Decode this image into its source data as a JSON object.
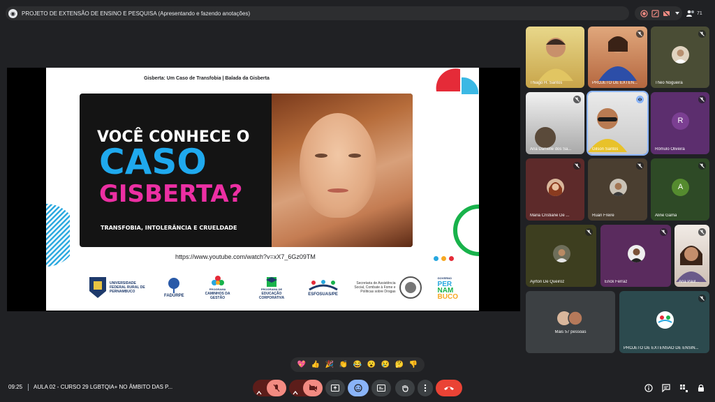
{
  "meeting": {
    "presentation_title": "PROJETO DE EXTENSÃO DE ENSINO E PESQUISA (Apresentando e fazendo anotações)",
    "participant_count": "71",
    "time": "09:25",
    "name": "AULA 02 - CURSO 29 LGBTQIA+ NO ÂMBITO DAS P..."
  },
  "slide": {
    "title": "Gisberta: Um Caso de Transfobia | Balada da Gisberta",
    "line1": "VOCÊ CONHECE O",
    "line2": "CASO",
    "line3": "GISBERTA?",
    "subtitle": "TRANSFOBIA, INTOLERÂNCIA E CRUELDADE",
    "url": "https://www.youtube.com/watch?v=xX7_6Gz09TM",
    "logos": {
      "ufrpe": "UNIVERSIDADE FEDERAL RURAL DE PERNAMBUCO",
      "fadurpe": "FADURPE",
      "caminhos_top": "PROGRAMA",
      "caminhos": "CAMINHOS DA GESTÃO",
      "educacao_top": "PROGRAMA DE",
      "educacao": "EDUCAÇÃO CORPORATIVA",
      "esfosuas": "ESFOSUAS/PE",
      "secretaria": "Secretaria de Assistência Social, Combate à Fome e Políticas sobre Drogas",
      "governo_top": "GOVERNO",
      "governo_1": "PER",
      "governo_2": "NAM",
      "governo_3": "BUCO"
    }
  },
  "participants": [
    {
      "name": "Thiago H. Santos"
    },
    {
      "name": "PROJETO DE EXTEN..."
    },
    {
      "name": "Théo Nogueira"
    },
    {
      "name": "Ana Danielle dos Sa..."
    },
    {
      "name": "Gilson Santos"
    },
    {
      "name": "Rômulo Oliveira",
      "initial": "R"
    },
    {
      "name": "Maria Cristiane De ..."
    },
    {
      "name": "Ruan Freire"
    },
    {
      "name": "Aline Gama",
      "initial": "A"
    },
    {
      "name": "Ayrton De Queiroz"
    },
    {
      "name": "Erick Ferraz"
    },
    {
      "name": "Ana Paul..."
    },
    {
      "name": "Mais 57 pessoas"
    },
    {
      "name": "PROJETO DE EXTENSÃO DE ENSIN..."
    }
  ],
  "reactions": [
    "💖",
    "👍",
    "🎉",
    "👏",
    "😂",
    "😮",
    "😢",
    "🤔",
    "👎"
  ],
  "colors": {
    "end_call": "#ea4335",
    "mic_off_bg": "#5c1d1a",
    "active": "#8ab4f8"
  }
}
